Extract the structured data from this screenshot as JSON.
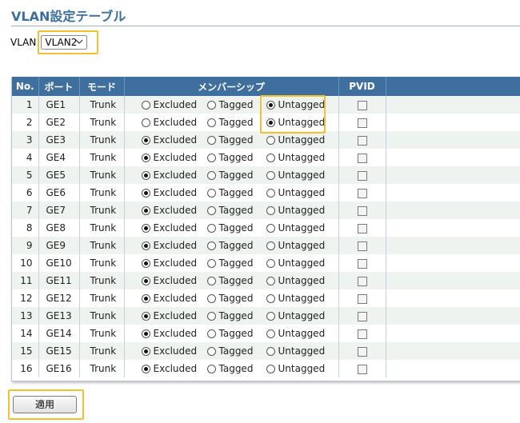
{
  "page": {
    "title": "VLAN設定テーブル"
  },
  "vlan_select": {
    "label": "VLAN",
    "value": "VLAN2"
  },
  "table": {
    "headers": {
      "no": "No.",
      "port": "ポート",
      "mode": "モード",
      "membership": "メンバーシップ",
      "pvid": "PVID"
    },
    "option_labels": {
      "excluded": "Excluded",
      "tagged": "Tagged",
      "untagged": "Untagged"
    },
    "rows": [
      {
        "no": "1",
        "port": "GE1",
        "mode": "Trunk",
        "membership": "untagged",
        "pvid": false
      },
      {
        "no": "2",
        "port": "GE2",
        "mode": "Trunk",
        "membership": "untagged",
        "pvid": false
      },
      {
        "no": "3",
        "port": "GE3",
        "mode": "Trunk",
        "membership": "excluded",
        "pvid": false
      },
      {
        "no": "4",
        "port": "GE4",
        "mode": "Trunk",
        "membership": "excluded",
        "pvid": false
      },
      {
        "no": "5",
        "port": "GE5",
        "mode": "Trunk",
        "membership": "excluded",
        "pvid": false
      },
      {
        "no": "6",
        "port": "GE6",
        "mode": "Trunk",
        "membership": "excluded",
        "pvid": false
      },
      {
        "no": "7",
        "port": "GE7",
        "mode": "Trunk",
        "membership": "excluded",
        "pvid": false
      },
      {
        "no": "8",
        "port": "GE8",
        "mode": "Trunk",
        "membership": "excluded",
        "pvid": false
      },
      {
        "no": "9",
        "port": "GE9",
        "mode": "Trunk",
        "membership": "excluded",
        "pvid": false
      },
      {
        "no": "10",
        "port": "GE10",
        "mode": "Trunk",
        "membership": "excluded",
        "pvid": false
      },
      {
        "no": "11",
        "port": "GE11",
        "mode": "Trunk",
        "membership": "excluded",
        "pvid": false
      },
      {
        "no": "12",
        "port": "GE12",
        "mode": "Trunk",
        "membership": "excluded",
        "pvid": false
      },
      {
        "no": "13",
        "port": "GE13",
        "mode": "Trunk",
        "membership": "excluded",
        "pvid": false
      },
      {
        "no": "14",
        "port": "GE14",
        "mode": "Trunk",
        "membership": "excluded",
        "pvid": false
      },
      {
        "no": "15",
        "port": "GE15",
        "mode": "Trunk",
        "membership": "excluded",
        "pvid": false
      },
      {
        "no": "16",
        "port": "GE16",
        "mode": "Trunk",
        "membership": "excluded",
        "pvid": false
      }
    ]
  },
  "apply_button": {
    "label": "適用"
  },
  "colors": {
    "header_bg": "#3f6f9e",
    "title": "#3c6e9e",
    "highlight": "#f2c22e",
    "row_alt": "#eef3f0"
  },
  "icons": {
    "select_arrow": "chevron-down-icon"
  }
}
